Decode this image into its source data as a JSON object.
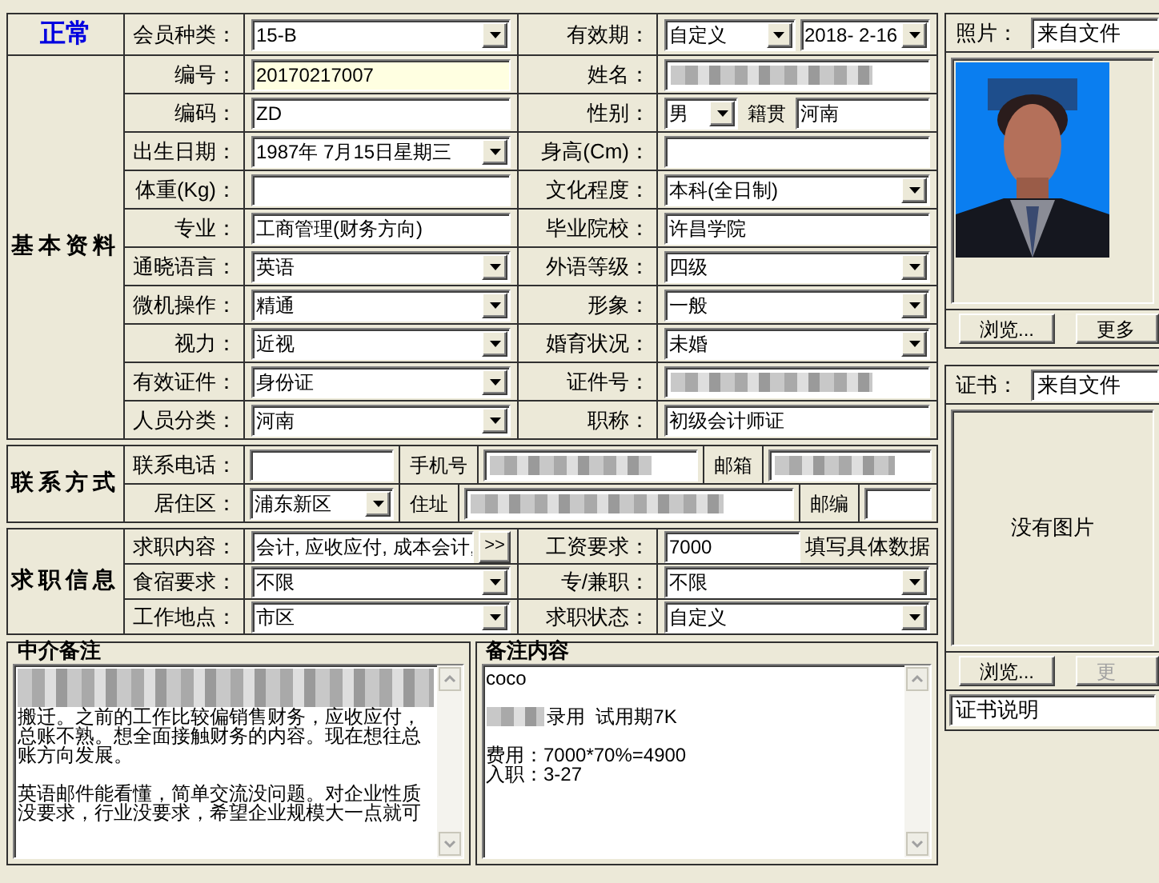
{
  "status": {
    "text": "正常"
  },
  "member": {
    "label": "会员种类：",
    "parts": [
      {
        "kind": "combo",
        "value": "15-B"
      }
    ]
  },
  "validity": {
    "label": "有效期：",
    "parts": [
      {
        "kind": "combo",
        "value": "自定义"
      },
      {
        "kind": "combo",
        "value": "2018- 2-16"
      }
    ]
  },
  "basic": {
    "title": "基本资料",
    "rows": [
      [
        {
          "label": "编号：",
          "parts": [
            {
              "kind": "text",
              "value": "20170217007",
              "focused": true
            }
          ]
        },
        {
          "label": "姓名：",
          "parts": [
            {
              "kind": "redacted"
            }
          ]
        }
      ],
      [
        {
          "label": "编码：",
          "parts": [
            {
              "kind": "text",
              "value": "ZD"
            }
          ]
        },
        {
          "label": "性别：",
          "parts": [
            {
              "kind": "combo",
              "value": "男"
            },
            {
              "kind": "label",
              "text": "籍贯"
            },
            {
              "kind": "text",
              "value": "河南"
            }
          ]
        }
      ],
      [
        {
          "label": "出生日期：",
          "parts": [
            {
              "kind": "combo",
              "value": "1987年 7月15日星期三"
            }
          ]
        },
        {
          "label": "身高(Cm)：",
          "parts": [
            {
              "kind": "text"
            }
          ]
        }
      ],
      [
        {
          "label": "体重(Kg)：",
          "parts": [
            {
              "kind": "text"
            }
          ]
        },
        {
          "label": "文化程度：",
          "parts": [
            {
              "kind": "combo",
              "value": "本科(全日制)"
            }
          ]
        }
      ],
      [
        {
          "label": "专业：",
          "parts": [
            {
              "kind": "text",
              "value": "工商管理(财务方向)"
            }
          ]
        },
        {
          "label": "毕业院校：",
          "parts": [
            {
              "kind": "text",
              "value": "许昌学院"
            }
          ]
        }
      ],
      [
        {
          "label": "通晓语言：",
          "parts": [
            {
              "kind": "combo",
              "value": "英语"
            }
          ]
        },
        {
          "label": "外语等级：",
          "parts": [
            {
              "kind": "combo",
              "value": "四级"
            }
          ]
        }
      ],
      [
        {
          "label": "微机操作：",
          "parts": [
            {
              "kind": "combo",
              "value": "精通"
            }
          ]
        },
        {
          "label": "形象：",
          "parts": [
            {
              "kind": "combo",
              "value": "一般"
            }
          ]
        }
      ],
      [
        {
          "label": "视力：",
          "parts": [
            {
              "kind": "combo",
              "value": "近视"
            }
          ]
        },
        {
          "label": "婚育状况：",
          "parts": [
            {
              "kind": "combo",
              "value": "未婚"
            }
          ]
        }
      ],
      [
        {
          "label": "有效证件：",
          "parts": [
            {
              "kind": "combo",
              "value": "身份证"
            }
          ]
        },
        {
          "label": "证件号：",
          "parts": [
            {
              "kind": "redacted"
            }
          ]
        }
      ],
      [
        {
          "label": "人员分类：",
          "parts": [
            {
              "kind": "combo",
              "value": "河南"
            }
          ]
        },
        {
          "label": "职称：",
          "parts": [
            {
              "kind": "text",
              "value": "初级会计师证"
            }
          ]
        }
      ]
    ]
  },
  "contact": {
    "title": "联系方式",
    "rows": [
      {
        "label": "联系电话：",
        "parts": [
          {
            "kind": "text"
          },
          {
            "kind": "label",
            "text": "手机号"
          },
          {
            "kind": "redacted"
          },
          {
            "kind": "label",
            "text": "邮箱"
          },
          {
            "kind": "redacted"
          }
        ]
      },
      {
        "label": "居住区：",
        "parts": [
          {
            "kind": "combo",
            "value": "浦东新区"
          },
          {
            "kind": "label",
            "text": "住址"
          },
          {
            "kind": "redacted"
          },
          {
            "kind": "label",
            "text": "邮编"
          },
          {
            "kind": "text"
          }
        ]
      }
    ]
  },
  "job": {
    "title": "求职信息",
    "rows": [
      [
        {
          "label": "求职内容：",
          "parts": [
            {
              "kind": "text",
              "value": "会计, 应收应付, 成本会计,"
            },
            {
              "kind": "button",
              "text": ">>"
            }
          ]
        },
        {
          "label": "工资要求：",
          "parts": [
            {
              "kind": "text",
              "value": "7000"
            },
            {
              "kind": "note",
              "text": "填写具体数据"
            }
          ]
        }
      ],
      [
        {
          "label": "食宿要求：",
          "parts": [
            {
              "kind": "combo",
              "value": "不限"
            }
          ]
        },
        {
          "label": "专/兼职：",
          "parts": [
            {
              "kind": "combo",
              "value": "不限"
            }
          ]
        }
      ],
      [
        {
          "label": "工作地点：",
          "parts": [
            {
              "kind": "combo",
              "value": "市区"
            }
          ]
        },
        {
          "label": "求职状态：",
          "parts": [
            {
              "kind": "combo",
              "value": "自定义"
            }
          ]
        }
      ]
    ]
  },
  "memos": [
    {
      "title": "中介备注",
      "items": [
        {
          "kind": "redacted"
        },
        {
          "kind": "text",
          "text": "搬迁。之前的工作比较偏销售财务，应收应付，总账不熟。想全面接触财务的内容。现在想往总账方向发展。"
        },
        {
          "kind": "text",
          "text": "英语邮件能看懂，简单交流没问题。对企业性质没要求，行业没要求，希望企业规模大一点就可"
        }
      ]
    },
    {
      "title": "备注内容",
      "items": [
        {
          "kind": "text",
          "text": "coco"
        },
        {
          "kind": "redacted_text",
          "text": "录用  试用期7K"
        },
        {
          "kind": "text",
          "text": "费用：7000*70%=4900\n入职：3-27"
        }
      ]
    }
  ],
  "photo": {
    "label": "照片：",
    "source": "来自文件",
    "buttons": [
      {
        "text": "浏览...",
        "disabled": false
      },
      {
        "text": "更多",
        "disabled": false
      }
    ]
  },
  "certificate": {
    "label": "证书：",
    "source": "来自文件",
    "empty_message": "没有图片",
    "buttons": [
      {
        "text": "浏览...",
        "disabled": false
      },
      {
        "text": "更",
        "disabled": true
      }
    ],
    "caption": "证书说明"
  }
}
